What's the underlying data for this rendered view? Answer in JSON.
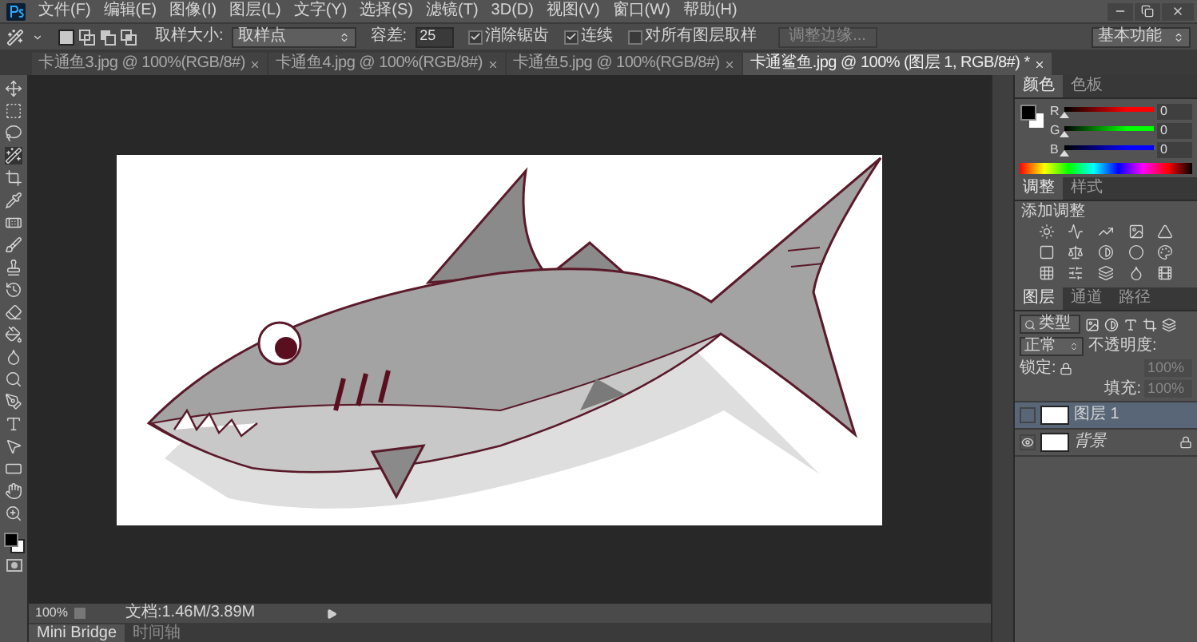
{
  "menu": [
    "文件(F)",
    "编辑(E)",
    "图像(I)",
    "图层(L)",
    "文字(Y)",
    "选择(S)",
    "滤镜(T)",
    "3D(D)",
    "视图(V)",
    "窗口(W)",
    "帮助(H)"
  ],
  "options": {
    "sample_size_label": "取样大小:",
    "sample_size": "取样点",
    "tolerance_label": "容差:",
    "tolerance": "25",
    "checkboxes": [
      {
        "label": "消除锯齿",
        "checked": true
      },
      {
        "label": "连续",
        "checked": true
      },
      {
        "label": "对所有图层取样",
        "checked": false
      }
    ],
    "refine_edge": {
      "label": "调整边缘...",
      "disabled": true
    },
    "workspace": "基本功能"
  },
  "tabs": [
    {
      "label": "卡通鱼3.jpg @ 100%(RGB/8#)",
      "selected": false
    },
    {
      "label": "卡通鱼4.jpg @ 100%(RGB/8#)",
      "selected": false
    },
    {
      "label": "卡通鱼5.jpg @ 100%(RGB/8#)",
      "selected": false
    },
    {
      "label": "卡通鲨鱼.jpg @ 100% (图层 1, RGB/8#) *",
      "selected": true
    }
  ],
  "color_panel": {
    "tabs": [
      {
        "label": "颜色",
        "selected": true
      },
      {
        "label": "色板",
        "selected": false
      }
    ],
    "channels": [
      {
        "name": "R",
        "value": "0",
        "level": 0,
        "color": "#ff0000"
      },
      {
        "name": "G",
        "value": "0",
        "level": 0,
        "color": "#00ff00"
      },
      {
        "name": "B",
        "value": "0",
        "level": 0,
        "color": "#0000ff"
      }
    ]
  },
  "adjustments_panel": {
    "tabs": [
      {
        "label": "调整",
        "selected": true
      },
      {
        "label": "样式",
        "selected": false
      }
    ],
    "heading": "添加调整"
  },
  "layers_panel": {
    "tabs": [
      {
        "label": "图层",
        "selected": true
      },
      {
        "label": "通道",
        "selected": false
      },
      {
        "label": "路径",
        "selected": false
      }
    ],
    "filter": "类型",
    "blend_mode": "正常",
    "opacity_label": "不透明度:",
    "opacity": "100%",
    "lock_label": "锁定:",
    "fill_label": "填充:",
    "fill": "100%",
    "layers": [
      {
        "name": "图层 1",
        "selected": true,
        "visible": false,
        "locked": false
      },
      {
        "name": "背景",
        "selected": false,
        "visible": true,
        "locked": true
      }
    ]
  },
  "status_bar": {
    "zoom": "100%",
    "doc_info": "文档:1.46M/3.89M"
  },
  "bottom_tabs": [
    {
      "label": "Mini Bridge",
      "selected": true
    },
    {
      "label": "时间轴",
      "selected": false
    }
  ]
}
